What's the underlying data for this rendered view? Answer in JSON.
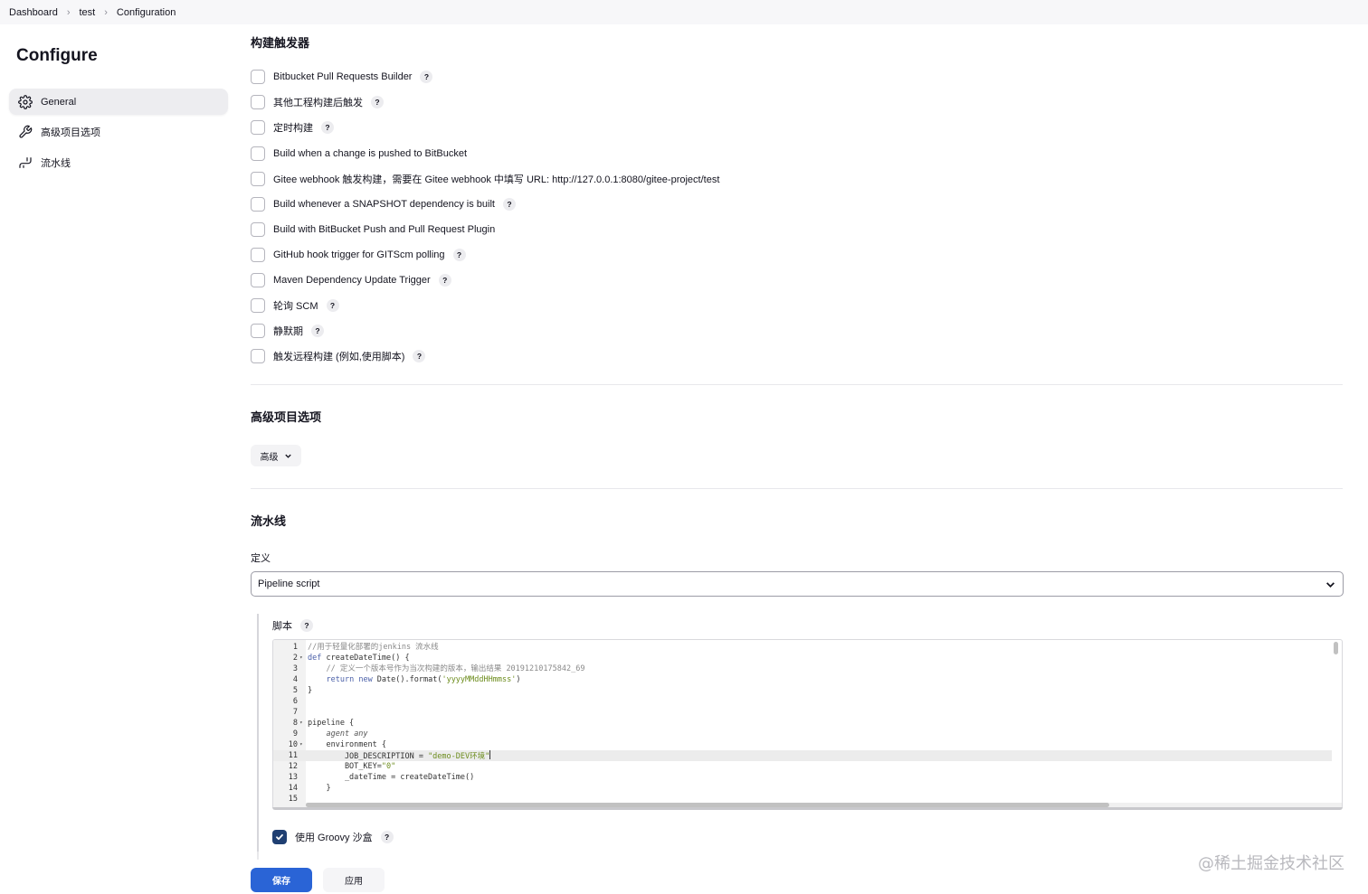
{
  "breadcrumb": {
    "items": [
      "Dashboard",
      "test",
      "Configuration"
    ]
  },
  "sidebar": {
    "title": "Configure",
    "items": [
      {
        "label": "General",
        "icon": "gear-icon",
        "active": true
      },
      {
        "label": "高级项目选项",
        "icon": "wrench-icon",
        "active": false
      },
      {
        "label": "流水线",
        "icon": "pipeline-icon",
        "active": false
      }
    ]
  },
  "triggers": {
    "title": "构建触发器",
    "items": [
      {
        "label": "Bitbucket Pull Requests Builder",
        "help": true
      },
      {
        "label": "其他工程构建后触发",
        "help": true
      },
      {
        "label": "定时构建",
        "help": true
      },
      {
        "label": "Build when a change is pushed to BitBucket",
        "help": false
      },
      {
        "label": "Gitee webhook 触发构建，需要在 Gitee webhook 中填写 URL: http://127.0.0.1:8080/gitee-project/test",
        "help": false
      },
      {
        "label": "Build whenever a SNAPSHOT dependency is built",
        "help": true
      },
      {
        "label": "Build with BitBucket Push and Pull Request Plugin",
        "help": false
      },
      {
        "label": "GitHub hook trigger for GITScm polling",
        "help": true
      },
      {
        "label": "Maven Dependency Update Trigger",
        "help": true
      },
      {
        "label": "轮询 SCM",
        "help": true
      },
      {
        "label": "静默期",
        "help": true
      },
      {
        "label": "触发远程构建 (例如,使用脚本)",
        "help": true
      }
    ]
  },
  "advanced": {
    "title": "高级项目选项",
    "button_label": "高级"
  },
  "pipeline": {
    "title": "流水线",
    "definition_label": "定义",
    "definition_value": "Pipeline script",
    "script_label": "脚本",
    "help_glyph": "?",
    "code_lines": [
      {
        "n": "1",
        "fold": false,
        "text": "//用于轻量化部署的jenkins 流水线",
        "kind": "comment"
      },
      {
        "n": "2",
        "fold": true,
        "text": "def createDateTime() {",
        "kind": "def"
      },
      {
        "n": "3",
        "fold": false,
        "text": "    // 定义一个版本号作为当次构建的版本，输出结果 20191210175842_69",
        "kind": "comment"
      },
      {
        "n": "4",
        "fold": false,
        "text": "    return new Date().format('yyyyMMddHHmmss')",
        "kind": "return"
      },
      {
        "n": "5",
        "fold": false,
        "text": "}",
        "kind": "plain"
      },
      {
        "n": "6",
        "fold": false,
        "text": "",
        "kind": "plain"
      },
      {
        "n": "7",
        "fold": false,
        "text": "",
        "kind": "plain"
      },
      {
        "n": "8",
        "fold": true,
        "text": "pipeline {",
        "kind": "plain"
      },
      {
        "n": "9",
        "fold": false,
        "text": "    agent any",
        "kind": "agent"
      },
      {
        "n": "10",
        "fold": true,
        "text": "    environment {",
        "kind": "plain"
      },
      {
        "n": "11",
        "fold": false,
        "text": "        JOB_DESCRIPTION = \"demo-DEV环境\"",
        "kind": "assign",
        "highlight": true
      },
      {
        "n": "12",
        "fold": false,
        "text": "        BOT_KEY=\"0\"",
        "kind": "assign"
      },
      {
        "n": "13",
        "fold": false,
        "text": "        _dateTime = createDateTime()",
        "kind": "plain"
      },
      {
        "n": "14",
        "fold": false,
        "text": "    }",
        "kind": "plain"
      },
      {
        "n": "15",
        "fold": false,
        "text": "",
        "kind": "plain"
      }
    ],
    "groovy_sandbox_label": "使用 Groovy 沙盒",
    "groovy_sandbox_checked": true
  },
  "actions": {
    "save_label": "保存",
    "apply_label": "应用"
  },
  "watermark": "@稀土掘金技术社区",
  "colors": {
    "primary": "#2a64d6",
    "checkbox_checked": "#1f3f72"
  }
}
